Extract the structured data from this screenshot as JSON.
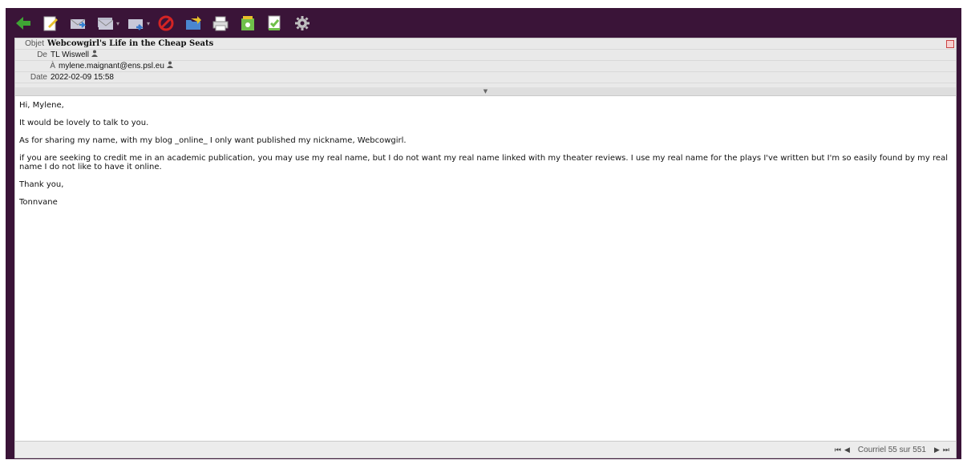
{
  "toolbar": {
    "items": [
      {
        "name": "back-icon",
        "color": "#3fa534"
      },
      {
        "name": "compose-icon",
        "color": "#e7c02a"
      },
      {
        "name": "reply-icon",
        "color": "#c8c8d8"
      },
      {
        "name": "reply-all-icon",
        "color": "#c8c8d8"
      },
      {
        "name": "forward-icon",
        "color": "#3a78c9"
      },
      {
        "name": "delete-icon",
        "color": "#d42424"
      },
      {
        "name": "move-icon",
        "color": "#4a86d0"
      },
      {
        "name": "print-icon",
        "color": "#dcdcdc"
      },
      {
        "name": "archive-icon",
        "color": "#6fc04a"
      },
      {
        "name": "mark-icon",
        "color": "#6fc04a"
      },
      {
        "name": "settings-icon",
        "color": "#c0c0c0"
      }
    ]
  },
  "headers": {
    "subject_label": "Objet",
    "subject": "Webcowgirl's Life in the Cheap Seats",
    "from_label": "De",
    "from": "TL Wiswell",
    "to_label": "À",
    "to": "mylene.maignant@ens.psl.eu",
    "date_label": "Date",
    "date": "2022-02-09 15:58",
    "collapse": "▼"
  },
  "body": {
    "lines": [
      "Hi, Mylene,",
      "It would be lovely to talk to you.",
      "As for sharing my name, with my blog _online_ I only want published my nickname, Webcowgirl.",
      "if you are seeking to credit me in an academic publication, you may use my real name, but I do not want my real name linked with my theater reviews. I use my real name for the plays I've written but I'm so easily found by my real name I do not like to have it online.",
      "Thank you,",
      "Tonnvane"
    ]
  },
  "footer": {
    "first": "⏮",
    "prev": "◀",
    "counter": "Courriel 55 sur 551",
    "next": "▶",
    "last": "⏭"
  }
}
